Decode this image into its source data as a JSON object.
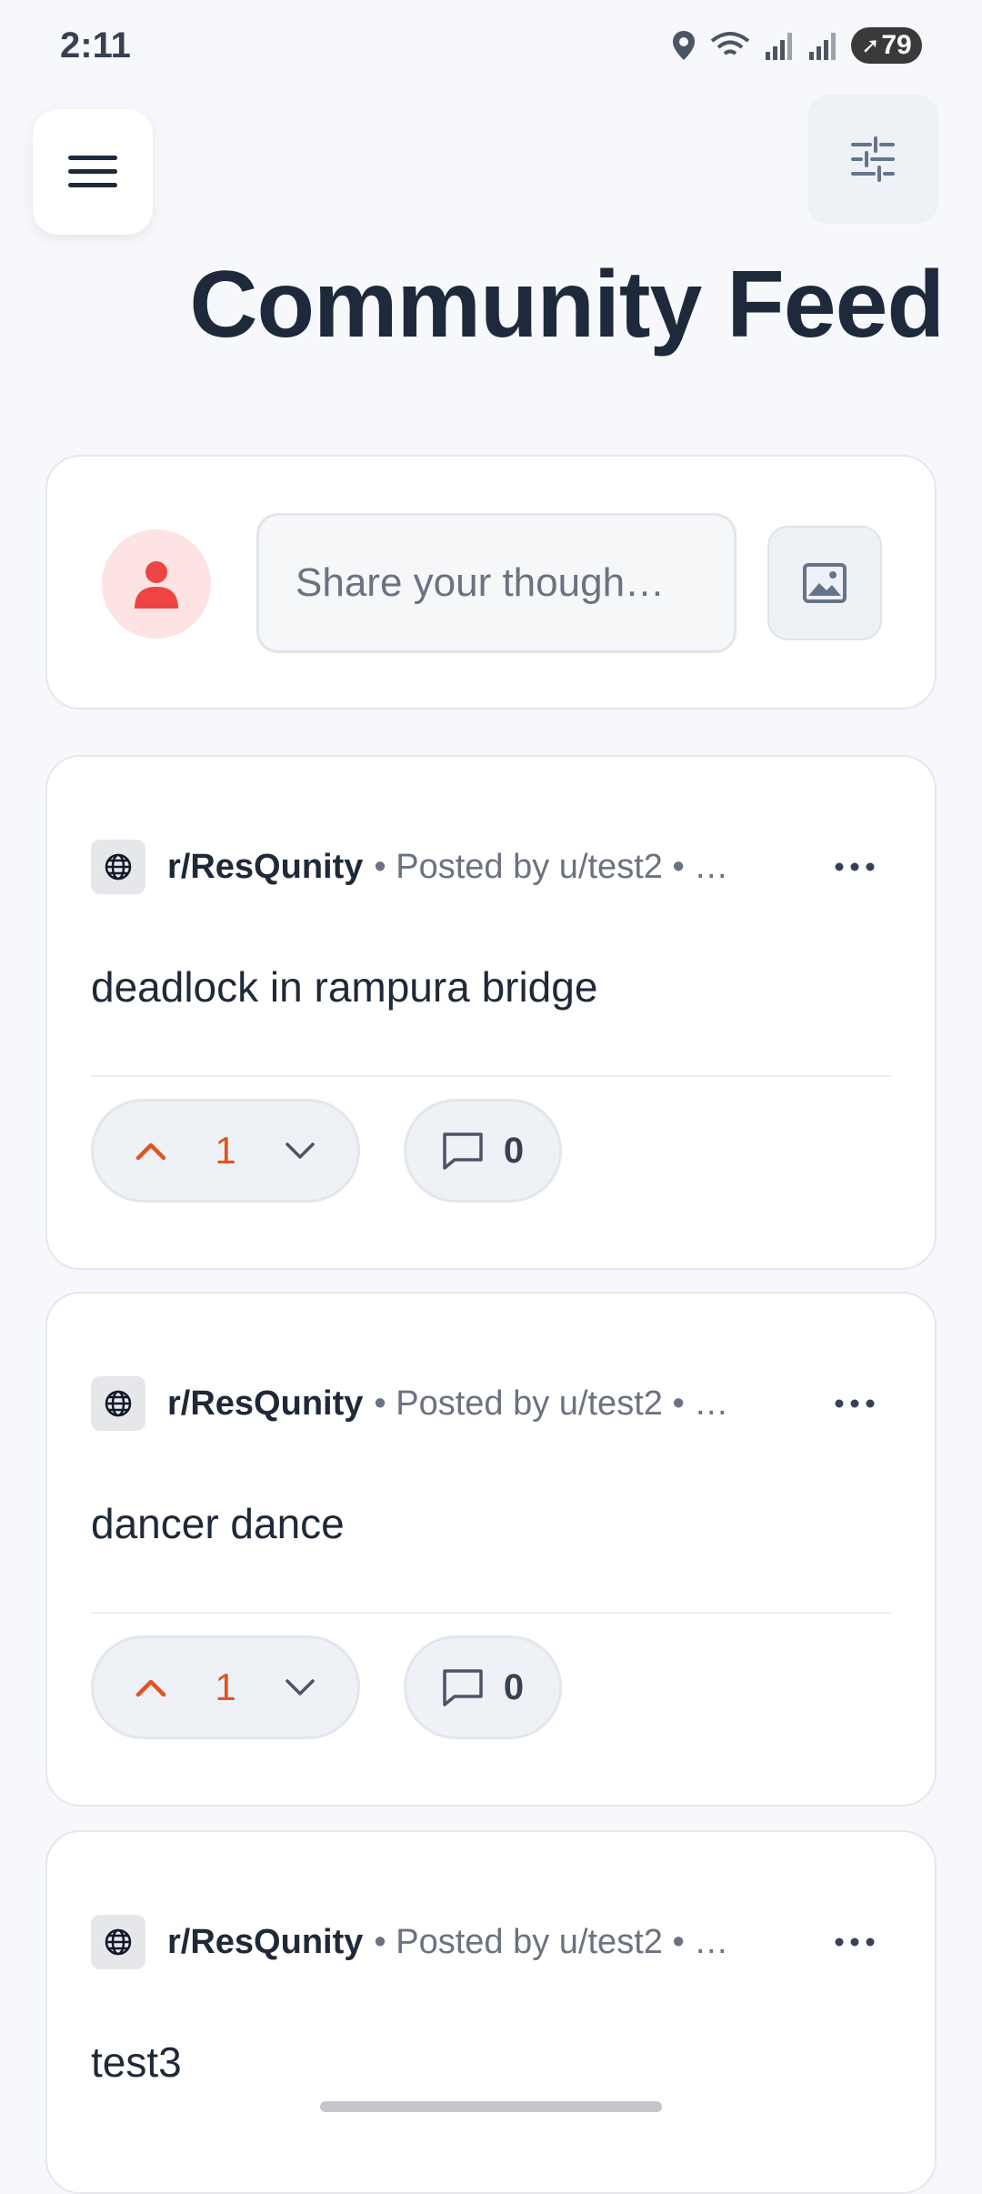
{
  "status_bar": {
    "time": "2:11",
    "battery": "79",
    "icons": [
      "location-icon",
      "wifi-icon",
      "signal-icon",
      "signal-icon",
      "battery-icon"
    ]
  },
  "header": {
    "title": "Community Feed",
    "menu_icon": "hamburger-menu-icon",
    "filter_icon": "sliders-icon"
  },
  "composer": {
    "placeholder": "Share your though…",
    "avatar_icon": "user-icon",
    "image_icon": "image-icon"
  },
  "posts": [
    {
      "subreddit": "r/ResQunity",
      "meta": "• Posted by u/test2 • …",
      "body": "deadlock in rampura bridge",
      "votes": "1",
      "comments": "0"
    },
    {
      "subreddit": "r/ResQunity",
      "meta": "• Posted by u/test2 • …",
      "body": "dancer dance",
      "votes": "1",
      "comments": "0"
    },
    {
      "subreddit": "r/ResQunity",
      "meta": "• Posted by u/test2 • …",
      "body": "test3"
    }
  ],
  "colors": {
    "accent": "#e2541f",
    "title": "#1e293b",
    "avatar_bg": "#fde3e3",
    "avatar_icon": "#ef4444"
  }
}
